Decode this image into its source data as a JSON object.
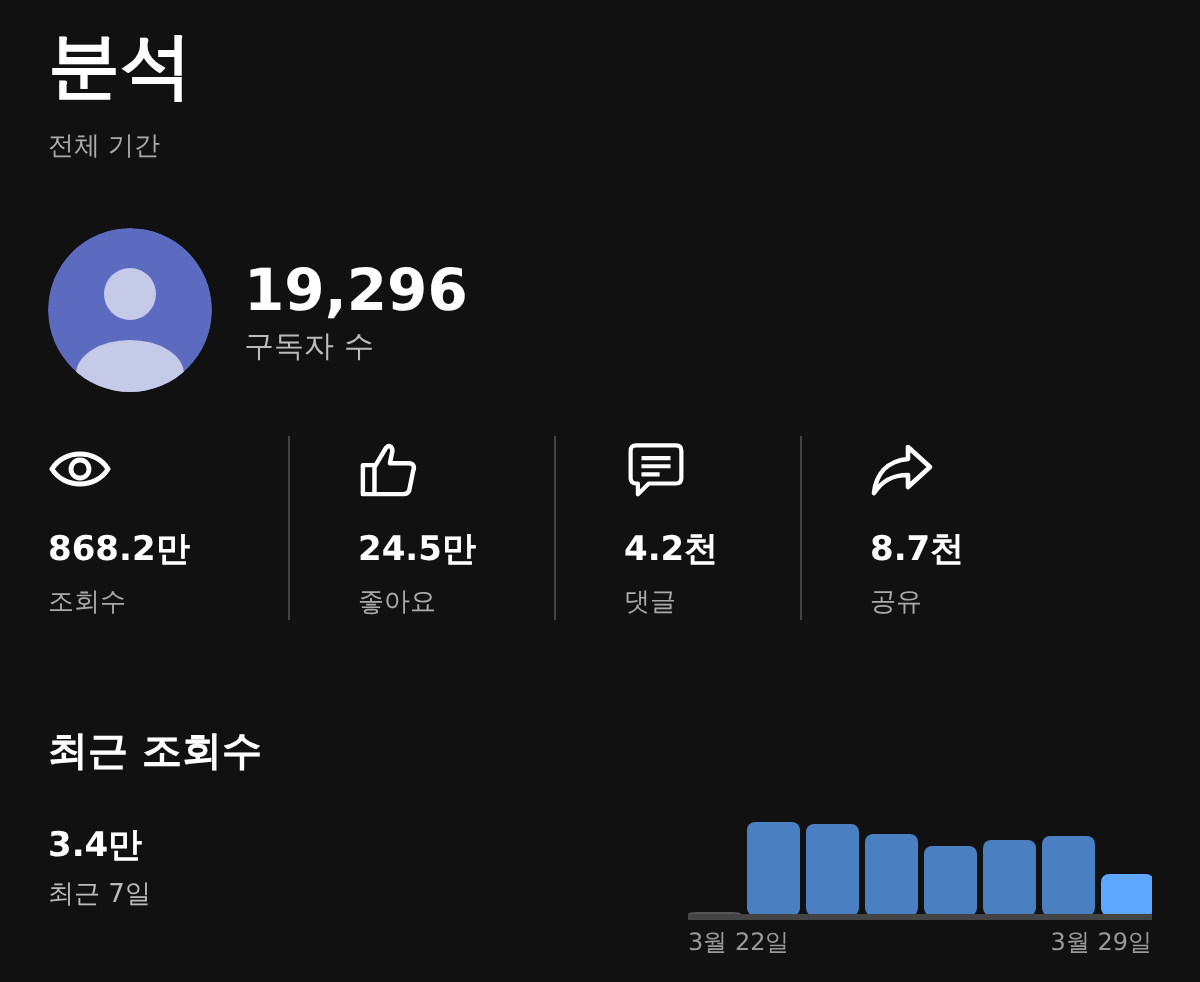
{
  "header": {
    "title": "분석",
    "subtitle": "전체 기간"
  },
  "channel": {
    "subscribers": "19,296",
    "subscribers_label": "구독자 수"
  },
  "stats": [
    {
      "kind": "views",
      "value": "868.2만",
      "label": "조회수"
    },
    {
      "kind": "likes",
      "value": "24.5만",
      "label": "좋아요"
    },
    {
      "kind": "comments",
      "value": "4.2천",
      "label": "댓글"
    },
    {
      "kind": "shares",
      "value": "8.7천",
      "label": "공유"
    }
  ],
  "recent": {
    "title": "최근 조회수",
    "value": "3.4만",
    "period": "최근 7일",
    "chart": {
      "start_label": "3월 22일",
      "end_label": "3월 29일"
    }
  }
}
